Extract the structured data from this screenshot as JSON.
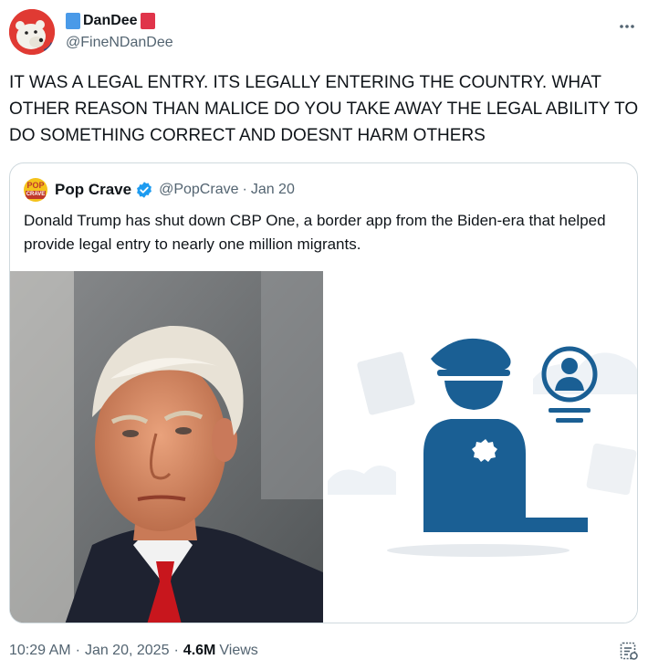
{
  "author": {
    "name": "DanDee",
    "handle": "@FineNDanDee",
    "flag_left_color": "#4a9ae8",
    "flag_right_color": "#e0344a"
  },
  "more_icon": "more-horizontal-icon",
  "tweet": {
    "text": "IT WAS A LEGAL ENTRY. ITS LEGALLY ENTERING THE COUNTRY. WHAT OTHER REASON THAN MALICE DO YOU TAKE AWAY THE LEGAL ABILITY TO DO SOMETHING CORRECT AND DOESNT HARM OTHERS"
  },
  "quote": {
    "logo_text_top": "POP",
    "logo_text_bottom": "CRAVE",
    "name": "Pop Crave",
    "verified_color": "#1d9bf0",
    "handle": "@PopCrave",
    "separator": "·",
    "date": "Jan 20",
    "text": "Donald Trump has shut down CBP One, a border app from the Biden-era that helped provide legal entry to nearly one million migrants."
  },
  "footer": {
    "time": "10:29 AM",
    "sep1": "·",
    "date": "Jan 20, 2025",
    "sep2": "·",
    "views_count": "4.6M",
    "views_label": "Views"
  },
  "colors": {
    "illustration_blue": "#1a5f94",
    "secondary_text": "#536471",
    "border": "#cfd9de"
  }
}
